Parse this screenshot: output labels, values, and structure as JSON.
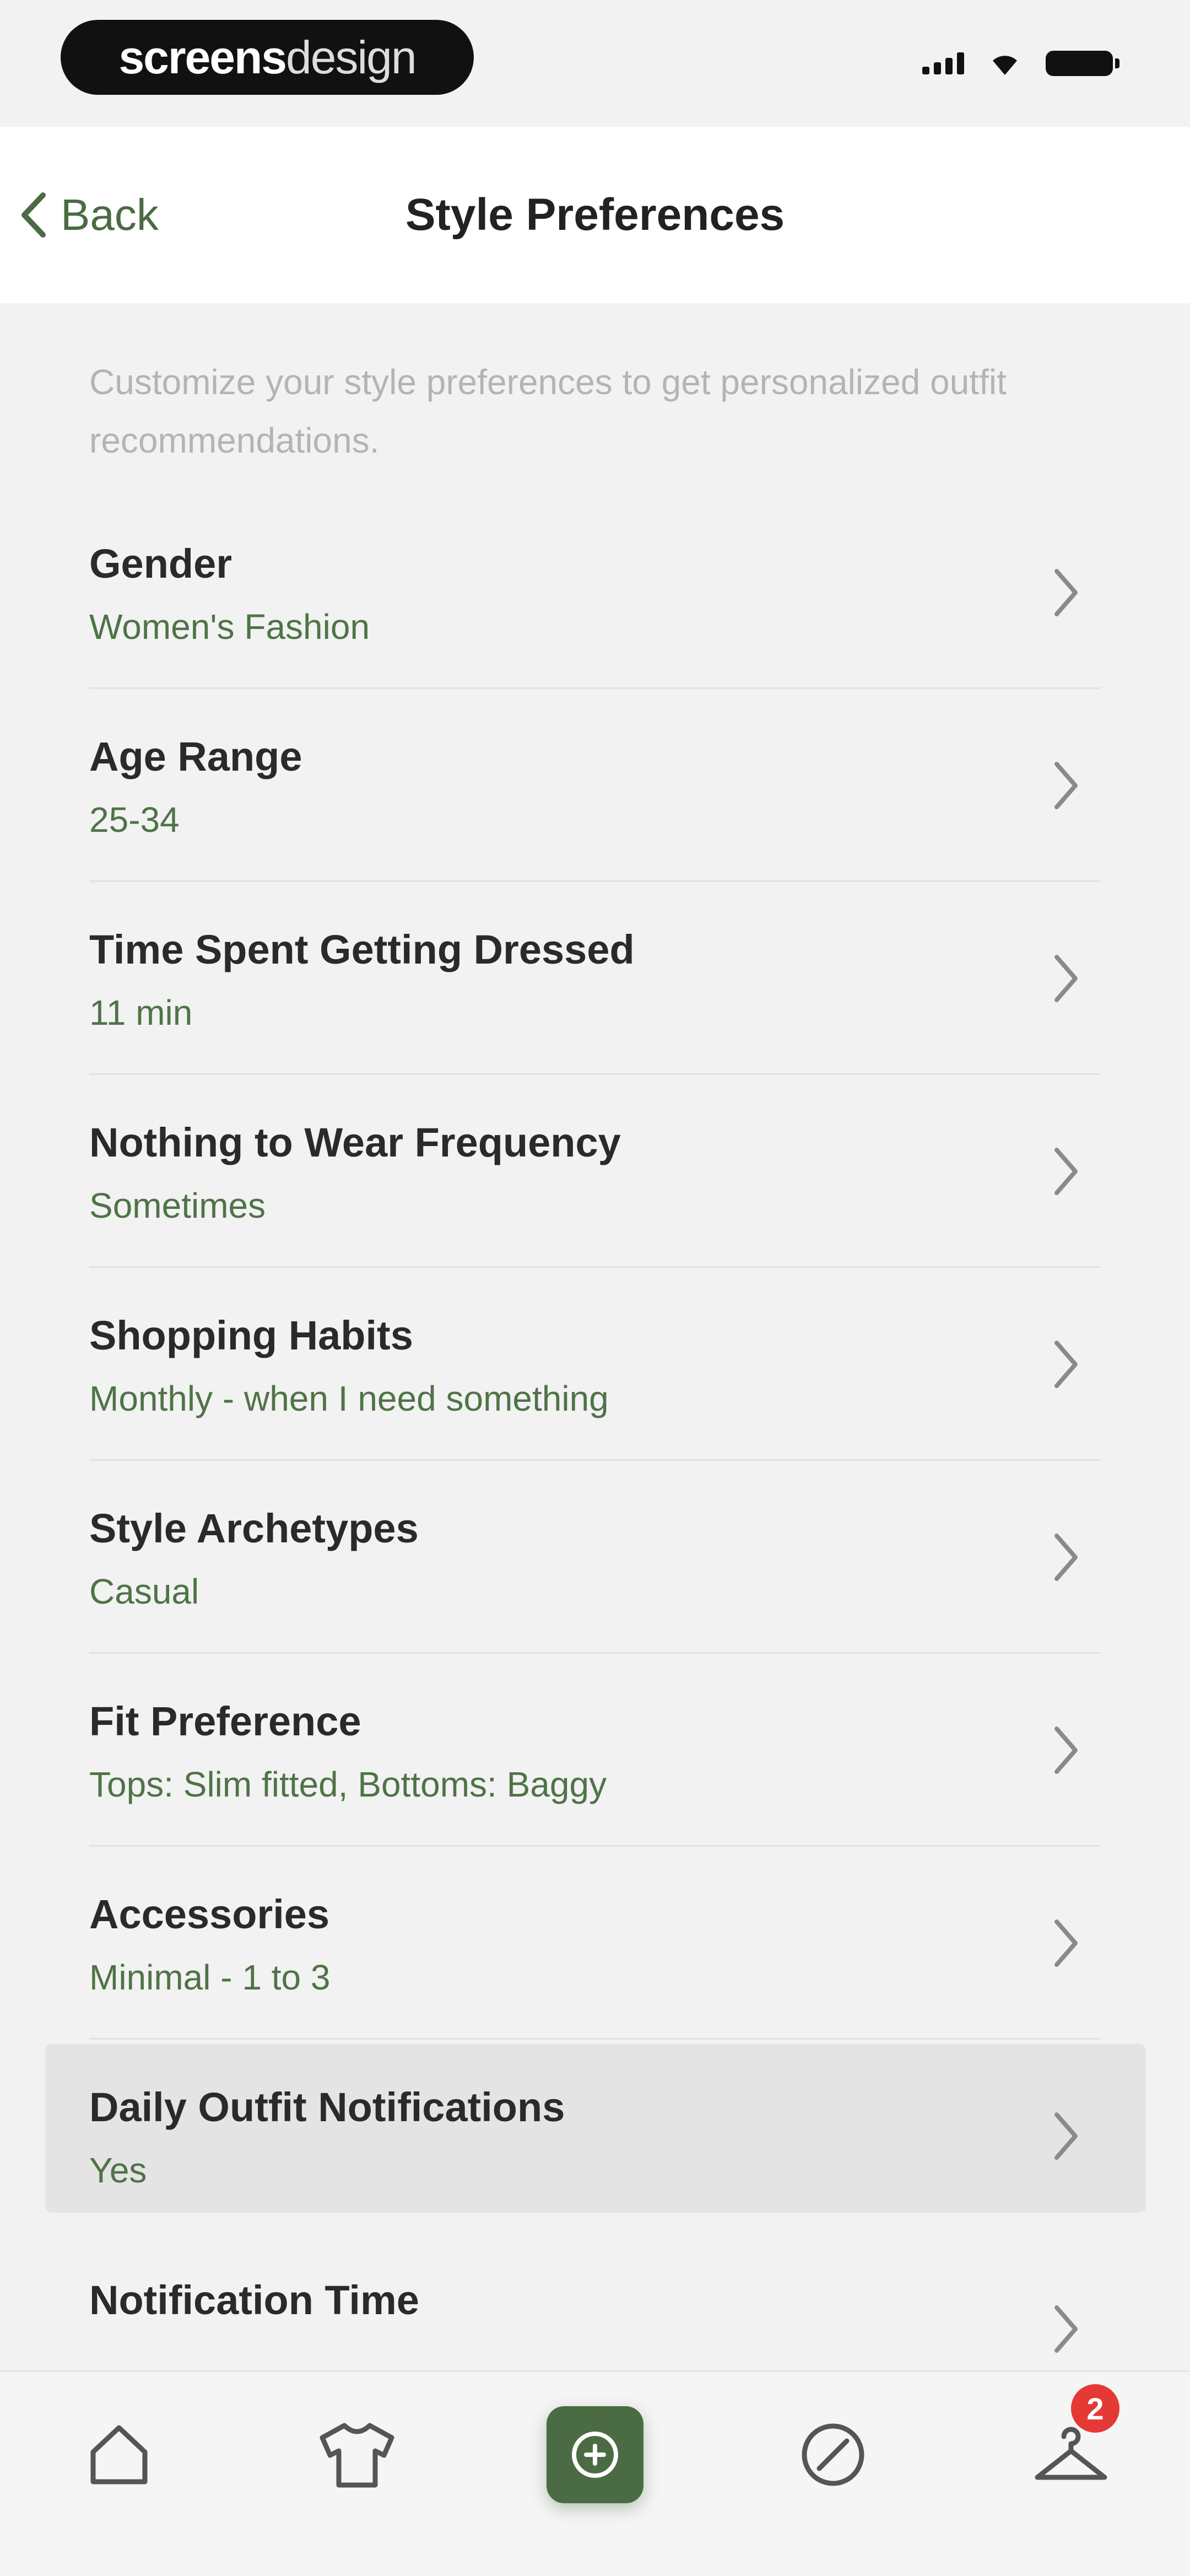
{
  "status_bar": {
    "brand_bold": "screens",
    "brand_light": "design"
  },
  "nav": {
    "back_label": "Back",
    "title": "Style Preferences"
  },
  "intro": "Customize your style preferences to get personalized outfit recommendations.",
  "preferences": [
    {
      "title": "Gender",
      "value": "Women's Fashion"
    },
    {
      "title": "Age Range",
      "value": "25-34"
    },
    {
      "title": "Time Spent Getting Dressed",
      "value": "11 min"
    },
    {
      "title": "Nothing to Wear Frequency",
      "value": "Sometimes"
    },
    {
      "title": "Shopping Habits",
      "value": "Monthly - when I need something"
    },
    {
      "title": "Style Archetypes",
      "value": "Casual"
    },
    {
      "title": "Fit Preference",
      "value": "Tops: Slim fitted, Bottoms: Baggy"
    },
    {
      "title": "Accessories",
      "value": "Minimal - 1 to 3"
    },
    {
      "title": "Daily Outfit Notifications",
      "value": "Yes"
    },
    {
      "title": "Notification Time",
      "value": ""
    }
  ],
  "tab_bar": {
    "tabs": [
      {
        "icon": "home-icon"
      },
      {
        "icon": "shirt-icon"
      },
      {
        "icon": "add-outfit-icon"
      },
      {
        "icon": "discover-icon"
      },
      {
        "icon": "hanger-icon"
      }
    ],
    "badge_count": "2"
  },
  "colors": {
    "accent": "#4a6b43",
    "badge": "#e53935",
    "background": "#f2f2f2"
  }
}
